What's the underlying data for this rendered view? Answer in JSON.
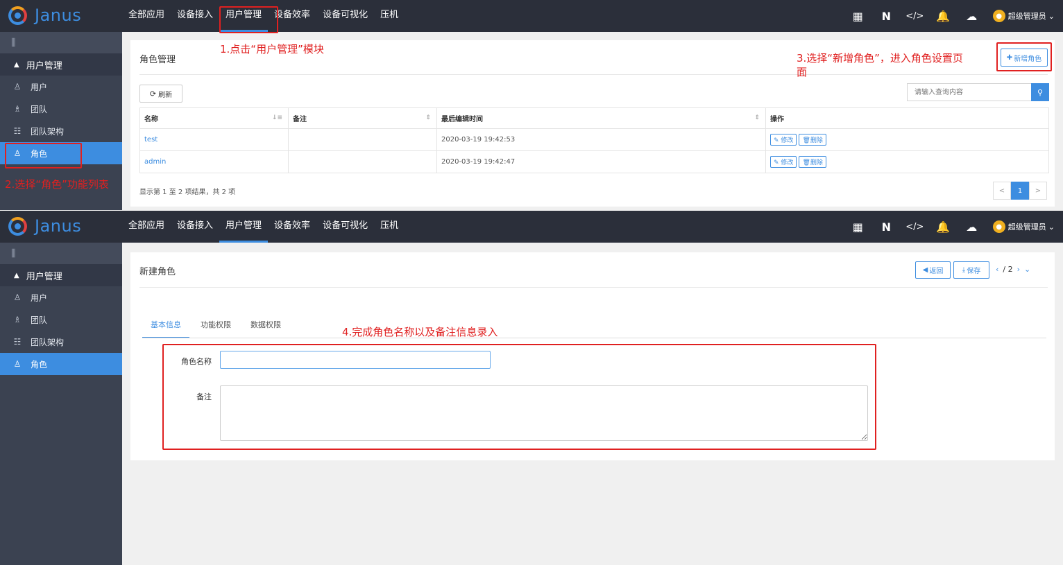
{
  "app": {
    "name": "Janus",
    "user": "超级管理员"
  },
  "nav": [
    "全部应用",
    "设备接入",
    "用户管理",
    "设备效率",
    "设备可视化",
    "压机"
  ],
  "sidebar": {
    "group": "用户管理",
    "items": [
      {
        "label": "用户",
        "icon": "user-icon"
      },
      {
        "label": "团队",
        "icon": "team-icon"
      },
      {
        "label": "团队架构",
        "icon": "org-icon"
      },
      {
        "label": "角色",
        "icon": "role-icon"
      }
    ]
  },
  "role_list": {
    "title": "角色管理",
    "add_button": "新增角色",
    "refresh_button": "刷新",
    "search_placeholder": "请输入查询内容",
    "columns": [
      "名称",
      "备注",
      "最后编辑时间",
      "操作"
    ],
    "rows": [
      {
        "name": "test",
        "remark": "",
        "time": "2020-03-19 19:42:53"
      },
      {
        "name": "admin",
        "remark": "",
        "time": "2020-03-19 19:42:47"
      }
    ],
    "edit_label": "修改",
    "delete_label": "删除",
    "footer": "显示第 1 至 2 项结果，共 2 项",
    "pager": {
      "prev": "<",
      "current": "1",
      "next": ">"
    }
  },
  "role_form": {
    "title": "新建角色",
    "back_button": "返回",
    "save_button": "保存",
    "page_indicator": "/ 2",
    "tabs": [
      "基本信息",
      "功能权限",
      "数据权限"
    ],
    "name_label": "角色名称",
    "remark_label": "备注",
    "name_value": "",
    "remark_value": ""
  },
  "annotations": {
    "step1": "1.点击“用户管理”模块",
    "step2": "2.选择“角色”功能列表",
    "step3_line1": "3.选择“新增角色”，进入角色设置页",
    "step3_line2": "面",
    "step4": "4.完成角色名称以及备注信息录入"
  },
  "colors": {
    "accent": "#3d8de0",
    "topbar": "#2b2f3a",
    "sidebar": "#3b4251",
    "annotation": "#e02020"
  }
}
